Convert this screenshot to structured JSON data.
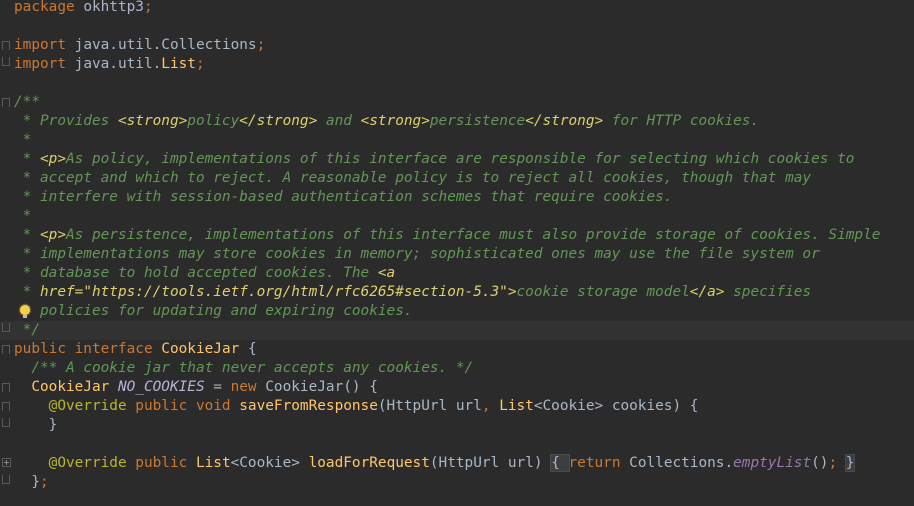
{
  "editor": {
    "language": "Java",
    "lines": [
      {
        "segments": [
          {
            "s": "kw",
            "t": "package "
          },
          {
            "s": "plain",
            "t": "okhttp3"
          },
          {
            "s": "punct",
            "t": ";"
          }
        ]
      },
      {
        "segments": []
      },
      {
        "fold": "start",
        "segments": [
          {
            "s": "kw",
            "t": "import "
          },
          {
            "s": "plain",
            "t": "java.util.Collections"
          },
          {
            "s": "punct",
            "t": ";"
          }
        ]
      },
      {
        "fold": "end",
        "segments": [
          {
            "s": "kw",
            "t": "import "
          },
          {
            "s": "plain",
            "t": "java.util."
          },
          {
            "s": "type",
            "t": "List"
          },
          {
            "s": "punct",
            "t": ";"
          }
        ]
      },
      {
        "segments": []
      },
      {
        "fold": "start",
        "segments": [
          {
            "s": "doc",
            "t": "/**"
          }
        ]
      },
      {
        "segments": [
          {
            "s": "doc",
            "t": " * Provides "
          },
          {
            "s": "tag",
            "t": "<strong>"
          },
          {
            "s": "doc",
            "t": "policy"
          },
          {
            "s": "tag",
            "t": "</strong>"
          },
          {
            "s": "doc",
            "t": " and "
          },
          {
            "s": "tag",
            "t": "<strong>"
          },
          {
            "s": "doc",
            "t": "persistence"
          },
          {
            "s": "tag",
            "t": "</strong>"
          },
          {
            "s": "doc",
            "t": " for HTTP cookies."
          }
        ]
      },
      {
        "segments": [
          {
            "s": "doc",
            "t": " *"
          }
        ]
      },
      {
        "segments": [
          {
            "s": "doc",
            "t": " * "
          },
          {
            "s": "tag",
            "t": "<p>"
          },
          {
            "s": "doc",
            "t": "As policy, implementations of this interface are responsible for selecting which cookies to"
          }
        ]
      },
      {
        "segments": [
          {
            "s": "doc",
            "t": " * accept and which to reject. A reasonable policy is to reject all cookies, though that may"
          }
        ]
      },
      {
        "segments": [
          {
            "s": "doc",
            "t": " * interfere with session-based authentication schemes that require cookies."
          }
        ]
      },
      {
        "segments": [
          {
            "s": "doc",
            "t": " *"
          }
        ]
      },
      {
        "segments": [
          {
            "s": "doc",
            "t": " * "
          },
          {
            "s": "tag",
            "t": "<p>"
          },
          {
            "s": "doc",
            "t": "As persistence, implementations of this interface must also provide storage of cookies. Simple"
          }
        ]
      },
      {
        "segments": [
          {
            "s": "doc",
            "t": " * implementations may store cookies in memory; sophisticated ones may use the file system or"
          }
        ]
      },
      {
        "segments": [
          {
            "s": "doc",
            "t": " * database to hold accepted cookies. The "
          },
          {
            "s": "tag",
            "t": "<a"
          }
        ]
      },
      {
        "segments": [
          {
            "s": "doc",
            "t": " * "
          },
          {
            "s": "tag",
            "t": "href=\"https://tools.ietf.org/html/rfc6265#section-5.3\">"
          },
          {
            "s": "doc",
            "t": "cookie storage model"
          },
          {
            "s": "tag",
            "t": "</a>"
          },
          {
            "s": "doc",
            "t": " specifies"
          }
        ]
      },
      {
        "bulb": true,
        "segments": [
          {
            "s": "doc",
            "t": " * policies for updating and expiring cookies."
          }
        ]
      },
      {
        "fold": "end",
        "current": true,
        "segments": [
          {
            "s": "doc",
            "t": " */"
          }
        ]
      },
      {
        "fold": "start",
        "segments": [
          {
            "s": "kw",
            "t": "public interface "
          },
          {
            "s": "type",
            "t": "CookieJar "
          },
          {
            "s": "plain",
            "t": "{"
          }
        ]
      },
      {
        "segments": [
          {
            "s": "doc",
            "t": "  /** A cookie jar that never accepts any cookies. */"
          }
        ]
      },
      {
        "fold": "start",
        "segments": [
          {
            "s": "type",
            "t": "  CookieJar "
          },
          {
            "s": "static",
            "t": "NO_COOKIES"
          },
          {
            "s": "plain",
            "t": " = "
          },
          {
            "s": "kw",
            "t": "new "
          },
          {
            "s": "plain",
            "t": "CookieJar() {"
          }
        ]
      },
      {
        "fold": "start",
        "segments": [
          {
            "s": "ann",
            "t": "    @Override "
          },
          {
            "s": "kw",
            "t": "public void "
          },
          {
            "s": "fn",
            "t": "saveFromResponse"
          },
          {
            "s": "plain",
            "t": "(HttpUrl url"
          },
          {
            "s": "punct",
            "t": ", "
          },
          {
            "s": "type",
            "t": "List"
          },
          {
            "s": "plain",
            "t": "<Cookie> cookies) {"
          }
        ]
      },
      {
        "fold": "end",
        "segments": [
          {
            "s": "plain",
            "t": "    }"
          }
        ]
      },
      {
        "segments": []
      },
      {
        "fold": "plus",
        "segments": [
          {
            "s": "ann",
            "t": "    @Override "
          },
          {
            "s": "kw",
            "t": "public "
          },
          {
            "s": "type",
            "t": "List"
          },
          {
            "s": "plain",
            "t": "<Cookie> "
          },
          {
            "s": "fn",
            "t": "loadForRequest"
          },
          {
            "s": "plain",
            "t": "(HttpUrl url) "
          },
          {
            "s": "box",
            "t": "{ "
          },
          {
            "s": "kw",
            "t": "return "
          },
          {
            "s": "plain",
            "t": "Collections."
          },
          {
            "s": "field",
            "t": "emptyList"
          },
          {
            "s": "plain",
            "t": "()"
          },
          {
            "s": "punct",
            "t": "; "
          },
          {
            "s": "box",
            "t": "}"
          }
        ]
      },
      {
        "fold": "end",
        "segments": [
          {
            "s": "plain",
            "t": "  }"
          },
          {
            "s": "punct",
            "t": ";"
          }
        ]
      }
    ]
  },
  "colors": {
    "background": "#2b2b2b",
    "keyword": "#cc7832",
    "doc": "#629755",
    "doc_tag": "#ded06c",
    "annotation": "#bbb529",
    "type": "#ffc66d",
    "static_field": "#9876aa",
    "plain": "#a9b7c6"
  },
  "icons": {
    "intention": "lightbulb-icon",
    "fold": "fold-marker-icon"
  }
}
